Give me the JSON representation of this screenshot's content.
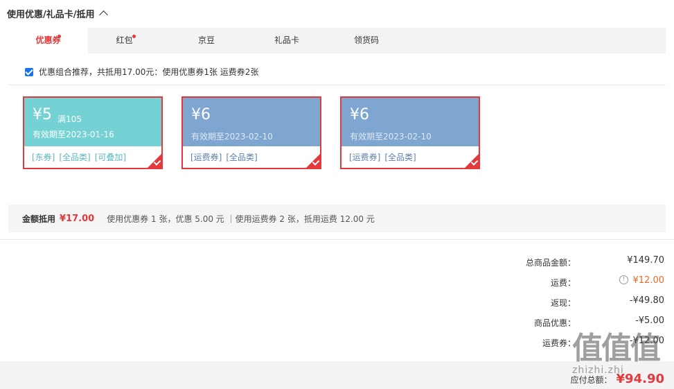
{
  "section": {
    "title": "使用优惠/礼品卡/抵用"
  },
  "tabs": [
    {
      "label": "优惠券",
      "active": true,
      "dot": true
    },
    {
      "label": "红包",
      "active": false,
      "dot": true
    },
    {
      "label": "京豆",
      "active": false,
      "dot": false
    },
    {
      "label": "礼品卡",
      "active": false,
      "dot": false
    },
    {
      "label": "领货码",
      "active": false,
      "dot": false
    }
  ],
  "combo": {
    "checked": true,
    "text": "优惠组合推荐，共抵用17.00元：使用优惠券1张 运费券2张"
  },
  "coupons": [
    {
      "amount": "¥5",
      "condition": "满105",
      "expiry": "有效期至2023-01-16",
      "tags": [
        "[东券]",
        "[全品类]",
        "[可叠加]"
      ],
      "color": "#74d2d4",
      "selected": true
    },
    {
      "amount": "¥6",
      "condition": "",
      "expiry": "有效期至2023-02-10",
      "tags": [
        "[运费券]",
        "[全品类]"
      ],
      "color": "#7ea6d0",
      "selected": true
    },
    {
      "amount": "¥6",
      "condition": "",
      "expiry": "有效期至2023-02-10",
      "tags": [
        "[运费券]",
        "[全品类]"
      ],
      "color": "#7ea6d0",
      "selected": true
    }
  ],
  "summary": {
    "label": "金额抵用",
    "amount": "¥17.00",
    "detail": "使用优惠券 1 张，优惠 5.00 元 ｜使用运费券 2 张，抵用运费 12.00 元"
  },
  "totals": [
    {
      "label": "总商品金额：",
      "value": "¥149.70"
    },
    {
      "label": "运费：",
      "value": "¥12.00",
      "highlight": "#f26522",
      "info_icon": "info-icon"
    },
    {
      "label": "返现：",
      "value": "-¥49.80"
    },
    {
      "label": "商品优惠：",
      "value": "-¥5.00"
    },
    {
      "label": "运费券：",
      "value": "-¥12.00"
    }
  ],
  "payable": {
    "label": "应付总额：",
    "value": "¥94.90"
  },
  "watermark": {
    "chars": "值值值",
    "url": "zhizhi.zhi"
  },
  "colors": {
    "accent": "#e4393c",
    "teal": "#74d2d4",
    "blue": "#7ea6d0",
    "orange": "#f26522"
  }
}
